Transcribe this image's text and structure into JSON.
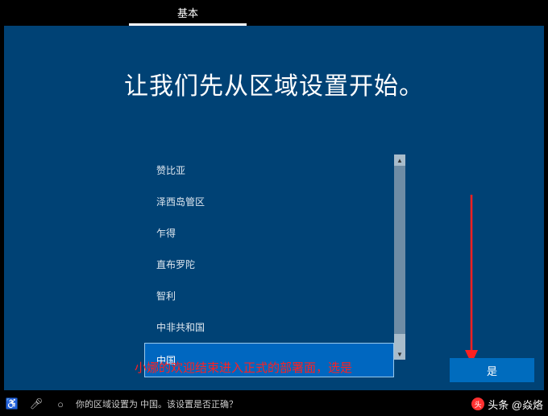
{
  "tab": {
    "label": "基本"
  },
  "title": "让我们先从区域设置开始。",
  "regions": {
    "items": [
      {
        "label": "赞比亚"
      },
      {
        "label": "泽西岛管区"
      },
      {
        "label": "乍得"
      },
      {
        "label": "直布罗陀"
      },
      {
        "label": "智利"
      },
      {
        "label": "中非共和国"
      },
      {
        "label": "中国"
      }
    ],
    "selected_index": 6
  },
  "annotation": "小娜的欢迎结束进入正式的部署面，选是",
  "confirm_button": "是",
  "bottom_bar": {
    "text": "你的区域设置为 中国。该设置是否正确？"
  },
  "watermark": {
    "logo": "头",
    "text": "头条 @焱烙"
  }
}
